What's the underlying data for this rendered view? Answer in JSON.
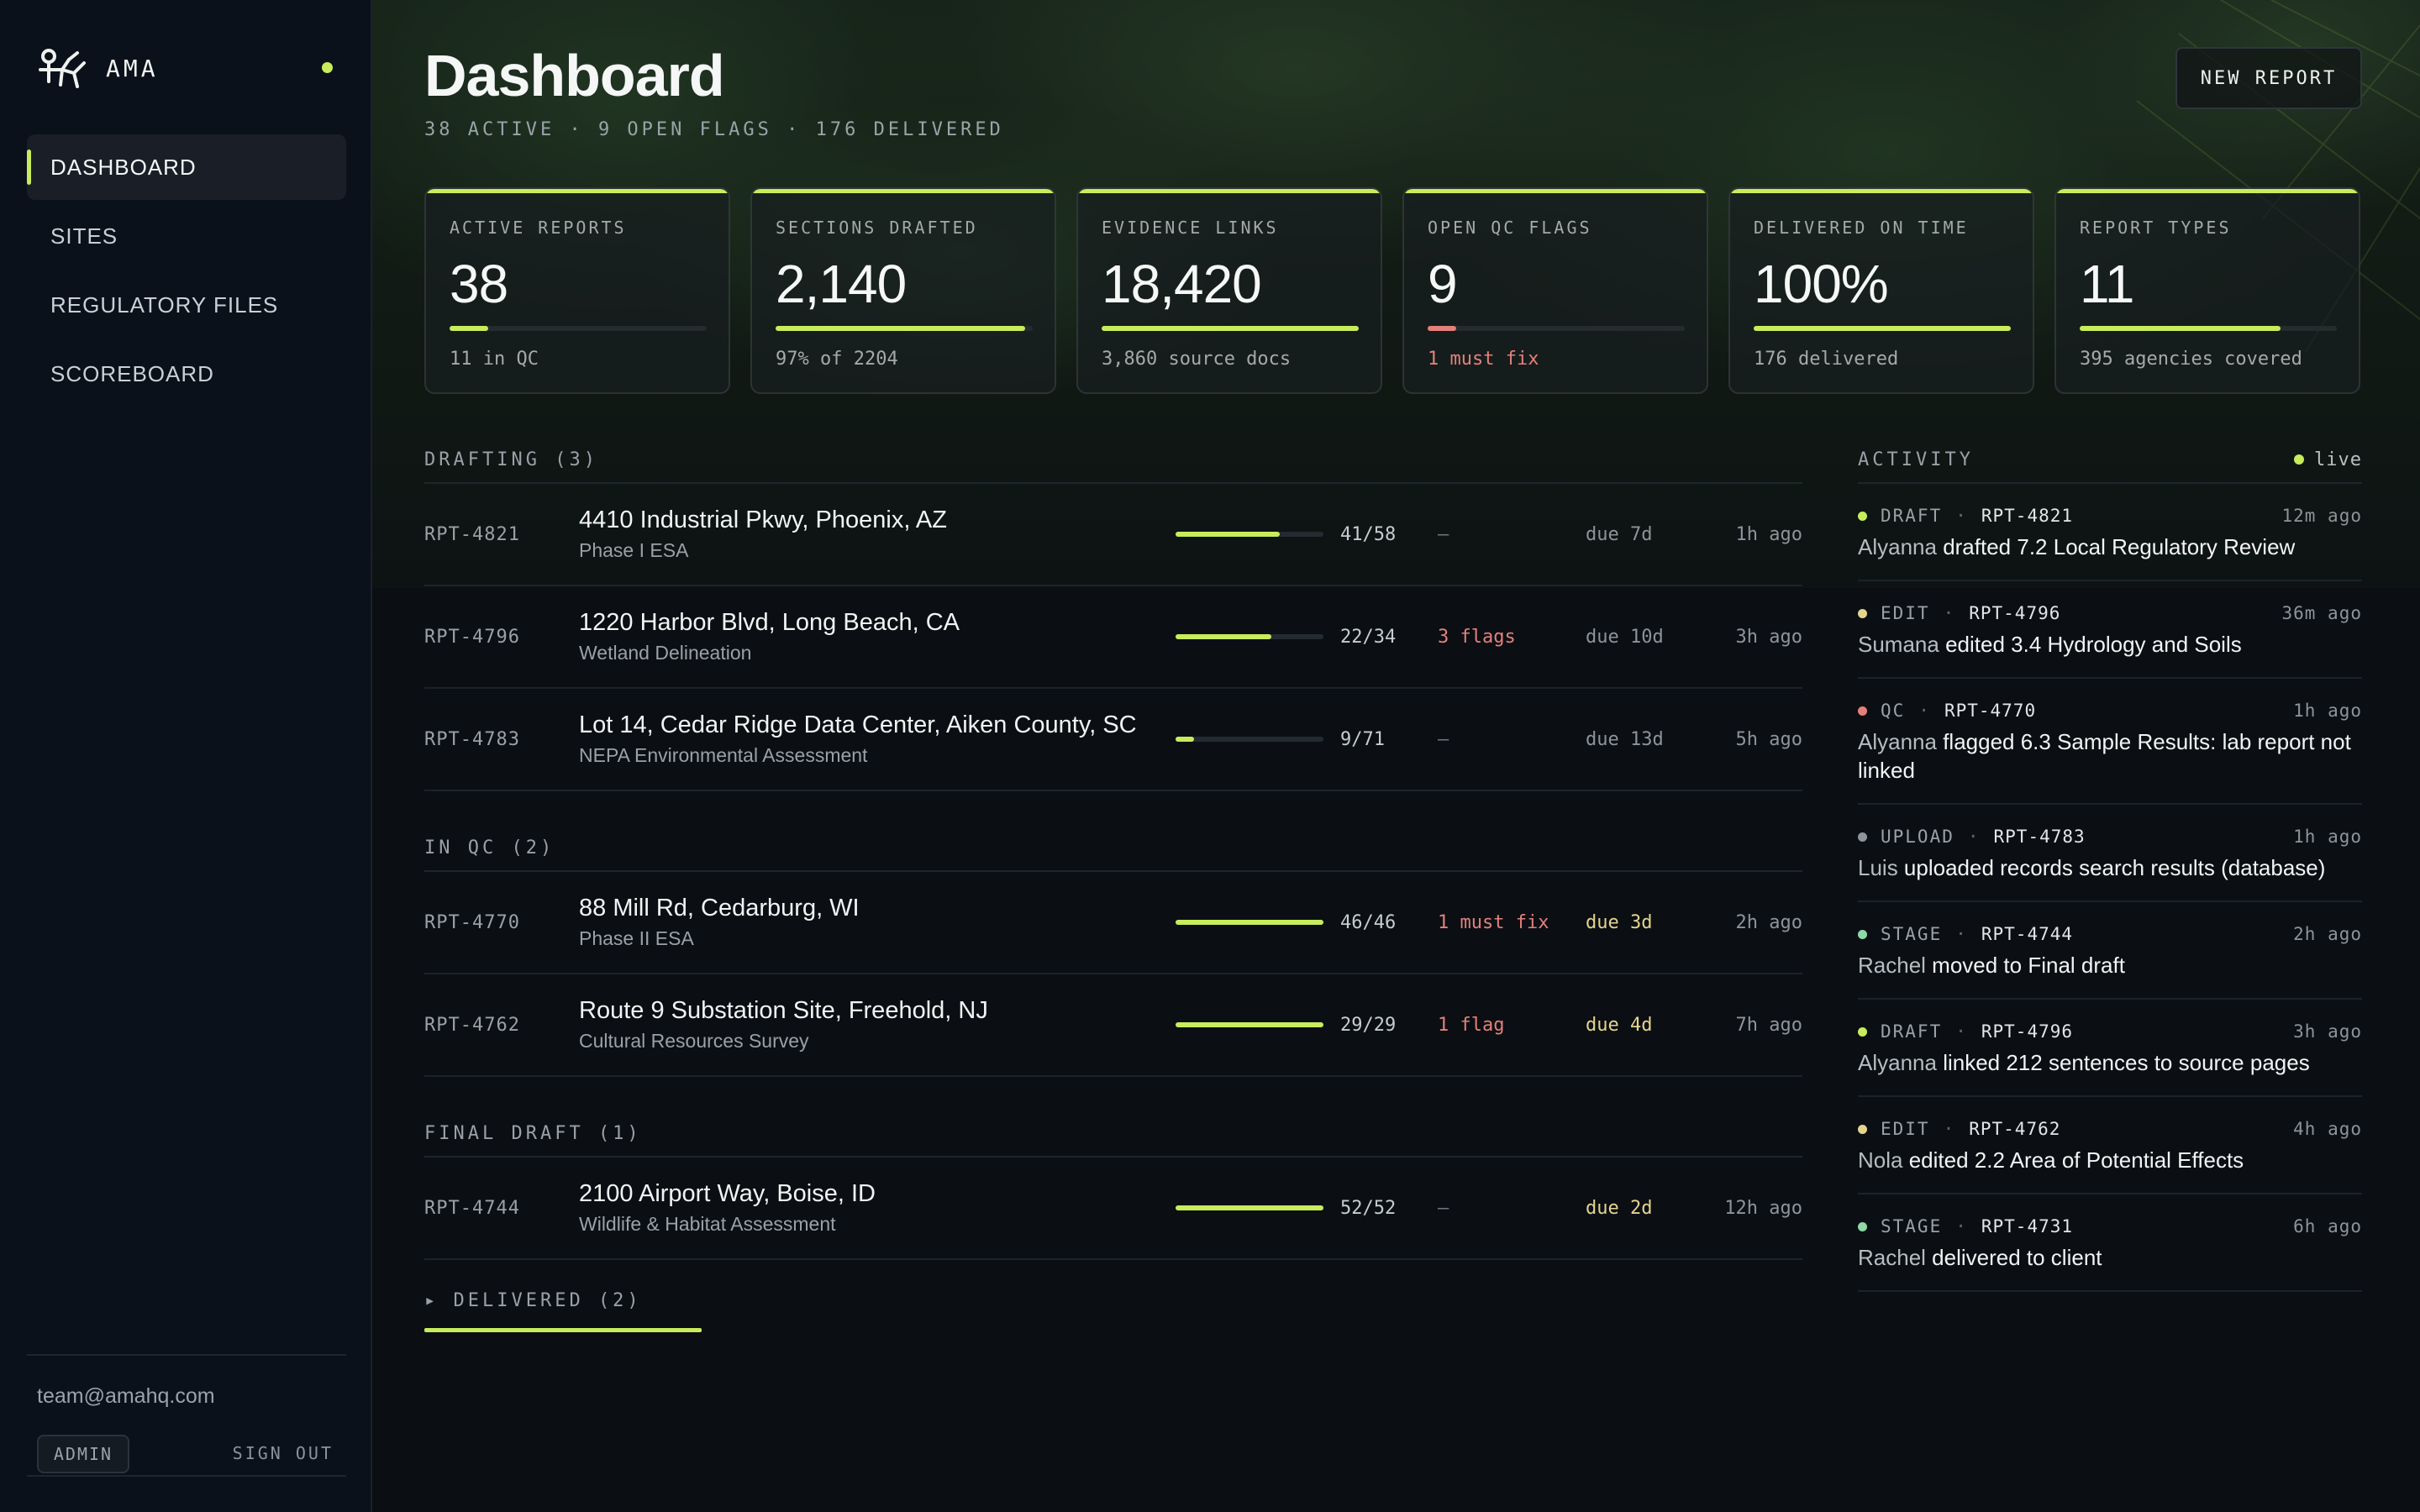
{
  "brand": {
    "name": "AMA",
    "status_color": "#c8ec5c"
  },
  "nav": [
    {
      "label": "DASHBOARD",
      "active": true
    },
    {
      "label": "SITES"
    },
    {
      "label": "REGULATORY FILES"
    },
    {
      "label": "SCOREBOARD"
    }
  ],
  "user": {
    "email": "team@amahq.com",
    "role": "ADMIN",
    "sign_out": "SIGN OUT"
  },
  "header": {
    "title": "Dashboard",
    "subtitle": "38 ACTIVE · 9 OPEN FLAGS · 176 DELIVERED",
    "new_report_label": "NEW REPORT"
  },
  "stats": [
    {
      "label": "ACTIVE REPORTS",
      "value": "38",
      "note": "11 in QC",
      "progress": 0.15
    },
    {
      "label": "SECTIONS DRAFTED",
      "value": "2,140",
      "note": "97% of 2204",
      "progress": 0.97
    },
    {
      "label": "EVIDENCE LINKS",
      "value": "18,420",
      "note": "3,860 source docs",
      "progress": 1.0
    },
    {
      "label": "OPEN QC FLAGS",
      "value": "9",
      "note": "1 must fix",
      "progress": 0.11,
      "alert": true
    },
    {
      "label": "DELIVERED ON TIME",
      "value": "100%",
      "note": "176 delivered",
      "progress": 1.0
    },
    {
      "label": "REPORT TYPES",
      "value": "11",
      "note": "395 agencies covered",
      "progress": 0.78
    }
  ],
  "pipeline": {
    "groups": [
      {
        "label": "DRAFTING (3)",
        "rows": [
          {
            "id": "RPT-4821",
            "title": "4410 Industrial Pkwy, Phoenix, AZ",
            "type": "Phase I ESA",
            "count": "41/58",
            "progress": 0.707,
            "flags": "—",
            "due": "due 7d",
            "ago": "1h ago"
          },
          {
            "id": "RPT-4796",
            "title": "1220 Harbor Blvd, Long Beach, CA",
            "type": "Wetland Delineation",
            "count": "22/34",
            "progress": 0.647,
            "flags": "3 flags",
            "due": "due 10d",
            "ago": "3h ago"
          },
          {
            "id": "RPT-4783",
            "title": "Lot 14, Cedar Ridge Data Center, Aiken County, SC",
            "type": "NEPA Environmental Assessment",
            "count": "9/71",
            "progress": 0.127,
            "flags": "—",
            "due": "due 13d",
            "ago": "5h ago"
          }
        ]
      },
      {
        "label": "IN QC (2)",
        "rows": [
          {
            "id": "RPT-4770",
            "title": "88 Mill Rd, Cedarburg, WI",
            "type": "Phase II ESA",
            "count": "46/46",
            "progress": 1.0,
            "flags": "1 must fix",
            "due": "due 3d",
            "due_soon": true,
            "ago": "2h ago"
          },
          {
            "id": "RPT-4762",
            "title": "Route 9 Substation Site, Freehold, NJ",
            "type": "Cultural Resources Survey",
            "count": "29/29",
            "progress": 1.0,
            "flags": "1 flag",
            "due": "due 4d",
            "due_soon": true,
            "ago": "7h ago"
          }
        ]
      },
      {
        "label": "FINAL DRAFT (1)",
        "rows": [
          {
            "id": "RPT-4744",
            "title": "2100 Airport Way, Boise, ID",
            "type": "Wildlife & Habitat Assessment",
            "count": "52/52",
            "progress": 1.0,
            "flags": "—",
            "due": "due 2d",
            "due_soon": true,
            "ago": "12h ago"
          }
        ]
      }
    ],
    "delivered_label": "▸ DELIVERED (2)"
  },
  "activity": {
    "label": "ACTIVITY",
    "live_label": "live",
    "items": [
      {
        "kind": "DRAFT",
        "color": "#c8ec5c",
        "id": "RPT-4821",
        "time": "12m ago",
        "actor": "Alyanna",
        "text": " drafted 7.2 Local Regulatory Review"
      },
      {
        "kind": "EDIT",
        "color": "#e5d48e",
        "id": "RPT-4796",
        "time": "36m ago",
        "actor": "Sumana",
        "text": " edited 3.4 Hydrology and Soils"
      },
      {
        "kind": "QC",
        "color": "#e4807a",
        "id": "RPT-4770",
        "time": "1h ago",
        "actor": "Alyanna",
        "text": " flagged 6.3 Sample Results: lab report not linked"
      },
      {
        "kind": "UPLOAD",
        "color": "#8d959b",
        "id": "RPT-4783",
        "time": "1h ago",
        "actor": "Luis",
        "text": " uploaded records search results (database)"
      },
      {
        "kind": "STAGE",
        "color": "#8fd8a8",
        "id": "RPT-4744",
        "time": "2h ago",
        "actor": "Rachel",
        "text": " moved to Final draft"
      },
      {
        "kind": "DRAFT",
        "color": "#c8ec5c",
        "id": "RPT-4796",
        "time": "3h ago",
        "actor": "Alyanna",
        "text": " linked 212 sentences to source pages"
      },
      {
        "kind": "EDIT",
        "color": "#e5d48e",
        "id": "RPT-4762",
        "time": "4h ago",
        "actor": "Nola",
        "text": " edited 2.2 Area of Potential Effects"
      },
      {
        "kind": "STAGE",
        "color": "#8fd8a8",
        "id": "RPT-4731",
        "time": "6h ago",
        "actor": "Rachel",
        "text": " delivered to client"
      }
    ]
  }
}
